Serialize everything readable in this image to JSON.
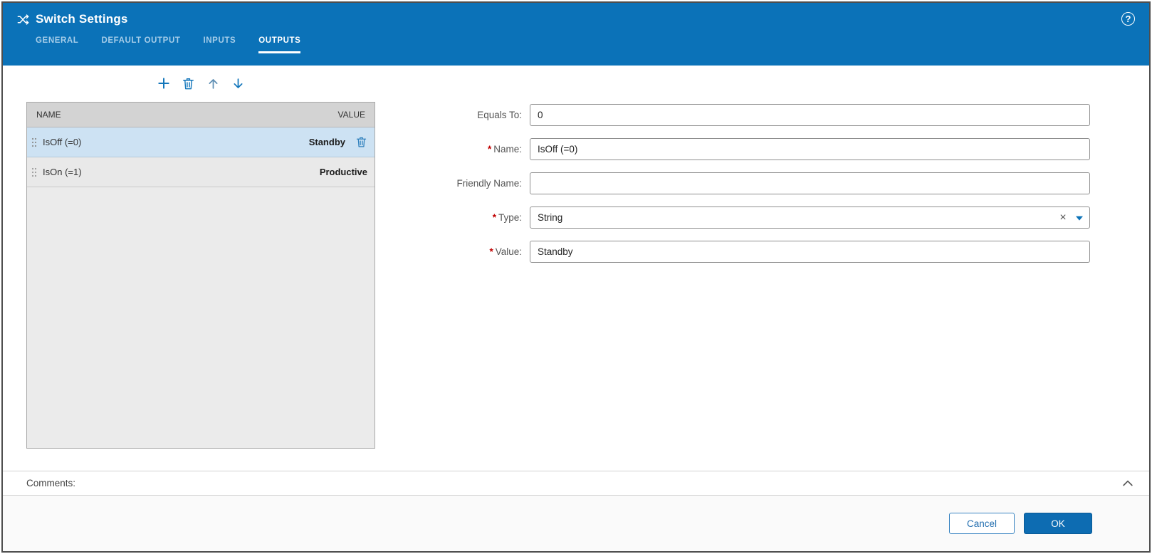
{
  "header": {
    "title": "Switch Settings",
    "help_glyph": "?",
    "tabs": [
      {
        "label": "GENERAL"
      },
      {
        "label": "DEFAULT OUTPUT"
      },
      {
        "label": "INPUTS"
      },
      {
        "label": "OUTPUTS"
      }
    ],
    "active_tab": "OUTPUTS"
  },
  "toolbar": {
    "icons": [
      {
        "name": "add-icon"
      },
      {
        "name": "delete-icon"
      },
      {
        "name": "move-up-icon"
      },
      {
        "name": "move-down-icon"
      }
    ]
  },
  "outputs_table": {
    "columns": {
      "name": "NAME",
      "value": "VALUE"
    },
    "rows": [
      {
        "name": "IsOff (=0)",
        "value": "Standby",
        "selected": true
      },
      {
        "name": "IsOn (=1)",
        "value": "Productive",
        "selected": false
      }
    ]
  },
  "form": {
    "required_marker": "*",
    "equals_to": {
      "label": "Equals To:",
      "value": "0",
      "required": false
    },
    "name": {
      "label": "Name:",
      "value": "IsOff (=0)",
      "required": true
    },
    "friendly_name": {
      "label": "Friendly Name:",
      "value": "",
      "required": false
    },
    "type": {
      "label": "Type:",
      "value": "String",
      "required": true,
      "clear_glyph": "×"
    },
    "value": {
      "label": "Value:",
      "value": "Standby",
      "required": true
    }
  },
  "comments": {
    "label": "Comments:"
  },
  "footer": {
    "cancel_label": "Cancel",
    "ok_label": "OK"
  },
  "colors": {
    "header_blue": "#0b72b8",
    "accent_blue": "#1477bb",
    "selected_row_bg": "#cde2f3",
    "table_header_bg": "#d3d3d3",
    "required_red": "#c00000",
    "ok_button_bg": "#0d6cb2"
  }
}
